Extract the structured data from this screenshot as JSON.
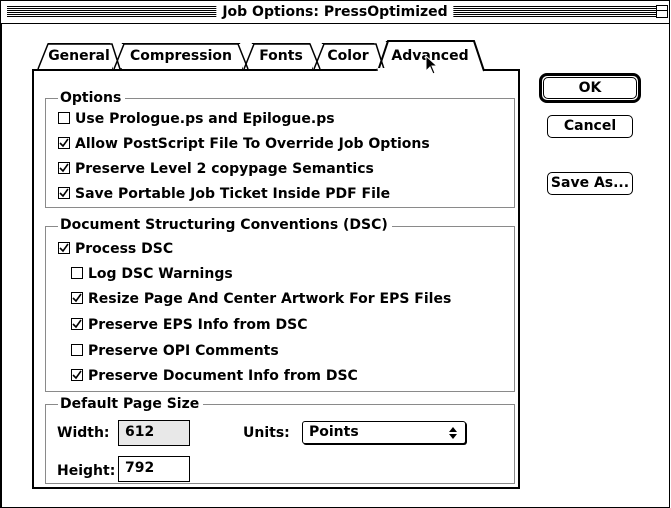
{
  "window": {
    "title": "Job Options: PressOptimized"
  },
  "tabs": [
    {
      "label": "General",
      "active": false
    },
    {
      "label": "Compression",
      "active": false
    },
    {
      "label": "Fonts",
      "active": false
    },
    {
      "label": "Color",
      "active": false
    },
    {
      "label": "Advanced",
      "active": true
    }
  ],
  "options_group": {
    "title": "Options",
    "items": [
      {
        "label": "Use Prologue.ps and Epilogue.ps",
        "checked": false
      },
      {
        "label": "Allow PostScript File To Override Job Options",
        "checked": true
      },
      {
        "label": "Preserve Level 2 copypage Semantics",
        "checked": true
      },
      {
        "label": "Save Portable Job Ticket Inside PDF File",
        "checked": true
      }
    ]
  },
  "dsc_group": {
    "title": "Document Structuring Conventions (DSC)",
    "process": {
      "label": "Process DSC",
      "checked": true
    },
    "items": [
      {
        "label": "Log DSC Warnings",
        "checked": false
      },
      {
        "label": "Resize Page And Center Artwork For EPS Files",
        "checked": true
      },
      {
        "label": "Preserve EPS Info from DSC",
        "checked": true
      },
      {
        "label": "Preserve OPI Comments",
        "checked": false
      },
      {
        "label": "Preserve Document Info from DSC",
        "checked": true
      }
    ]
  },
  "page_size_group": {
    "title": "Default Page Size",
    "width_label": "Width:",
    "width_value": "612",
    "height_label": "Height:",
    "height_value": "792",
    "units_label": "Units:",
    "units_value": "Points"
  },
  "buttons": {
    "ok": "OK",
    "cancel": "Cancel",
    "save_as": "Save As..."
  },
  "icons": {
    "zoom": "zoom-box-icon",
    "cursor": "arrow-cursor-icon",
    "popup": "updown-arrows-icon"
  }
}
